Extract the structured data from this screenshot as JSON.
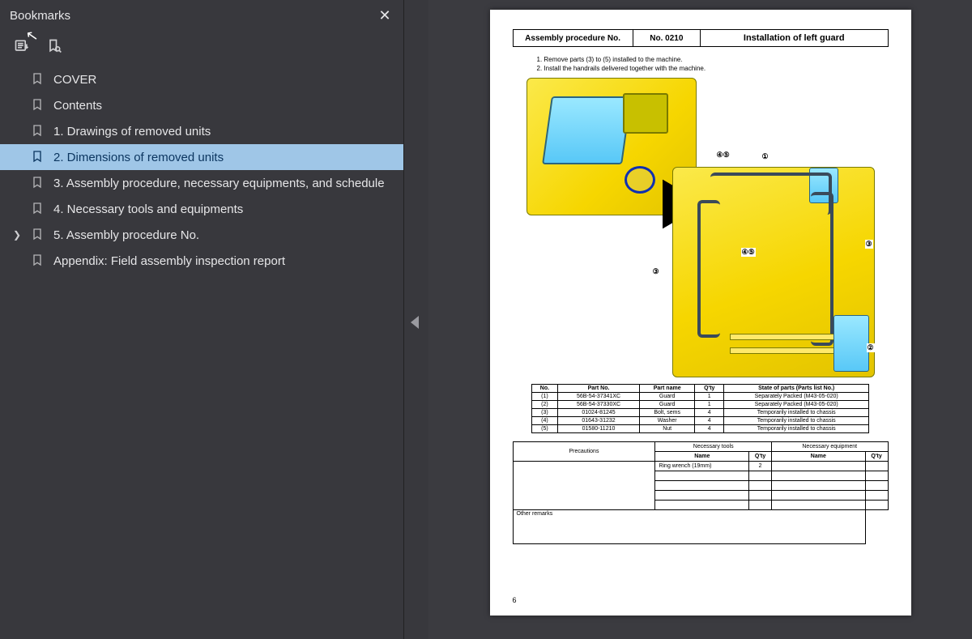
{
  "sidebar": {
    "title": "Bookmarks",
    "items": [
      {
        "label": "COVER",
        "expandable": false,
        "selected": false
      },
      {
        "label": "Contents",
        "expandable": false,
        "selected": false
      },
      {
        "label": "1. Drawings of removed units",
        "expandable": false,
        "selected": false
      },
      {
        "label": "2. Dimensions of removed units",
        "expandable": false,
        "selected": true
      },
      {
        "label": "3. Assembly procedure, necessary equipments, and schedule",
        "expandable": false,
        "selected": false
      },
      {
        "label": "4. Necessary tools and equipments",
        "expandable": false,
        "selected": false
      },
      {
        "label": "5. Assembly procedure No.",
        "expandable": true,
        "selected": false
      },
      {
        "label": "Appendix: Field assembly inspection report",
        "expandable": false,
        "selected": false
      }
    ]
  },
  "doc": {
    "header": {
      "col1": "Assembly procedure No.",
      "col2": "No. 0210",
      "title": "Installation of left guard"
    },
    "instructions": [
      "1. Remove parts (3) to (5) installed to the machine.",
      "2. Install the handrails delivered together with the machine."
    ],
    "callouts": {
      "c45a": "④⑤",
      "c1": "①",
      "c3a": "③",
      "c45b": "④⑤",
      "c3b": "③",
      "c2": "②"
    },
    "parts": {
      "headers": [
        "No.",
        "Part No.",
        "Part name",
        "Q'ty",
        "State of parts (Parts list No.)"
      ],
      "rows": [
        [
          "(1)",
          "56B-54-37341XC",
          "Guard",
          "1",
          "Separately Packed  (M43-05-020)"
        ],
        [
          "(2)",
          "56B-54-37330XC",
          "Guard",
          "1",
          "Separately Packed  (M43-05-020)"
        ],
        [
          "(3)",
          "01024-81245",
          "Bolt, sems",
          "4",
          "Temporarily  installed to chassis"
        ],
        [
          "(4)",
          "01643-31232",
          "Washer",
          "4",
          "Temporarily  installed to chassis"
        ],
        [
          "(5)",
          "01580-11210",
          "Nut",
          "4",
          "Temporarily  installed to chassis"
        ]
      ]
    },
    "bottom": {
      "precautions": "Precautions",
      "tools": "Necessary tools",
      "equip": "Necessary equipment",
      "name": "Name",
      "qty": "Q'ty",
      "tool_rows": [
        [
          "Ring wrench (19mm)",
          "2"
        ],
        [
          "",
          ""
        ],
        [
          "",
          ""
        ],
        [
          "",
          ""
        ],
        [
          "",
          ""
        ]
      ],
      "other": "Other remarks"
    },
    "page_number": "6"
  }
}
